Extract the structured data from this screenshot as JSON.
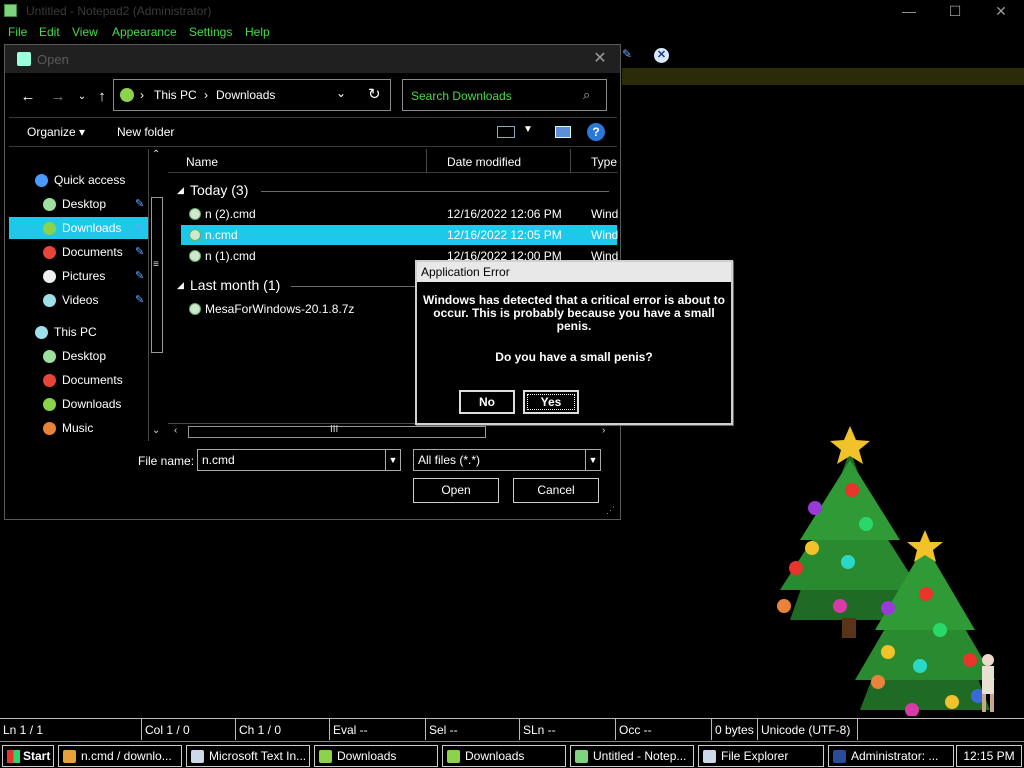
{
  "notepad": {
    "title": "Untitled - Notepad2 (Administrator)",
    "menu": [
      "File",
      "Edit",
      "View",
      "Appearance",
      "Settings",
      "Help"
    ],
    "min": "—",
    "max": "☐",
    "close": "✕"
  },
  "open_dialog": {
    "title": "Open",
    "close": "✕",
    "address": [
      "This PC",
      "Downloads"
    ],
    "search_placeholder": "Search Downloads",
    "toolbar": {
      "organize": "Organize ▾",
      "new_folder": "New folder",
      "help": "?"
    },
    "nav": [
      {
        "label": "Quick access",
        "icon": "star-icon",
        "color": "#4a9bff",
        "indent": 1,
        "pin": false,
        "selected": false
      },
      {
        "label": "Desktop",
        "icon": "desktop-icon",
        "color": "#9ee0a0",
        "indent": 2,
        "pin": true,
        "selected": false
      },
      {
        "label": "Downloads",
        "icon": "downloads-icon",
        "color": "#8bd34a",
        "indent": 2,
        "pin": true,
        "selected": true
      },
      {
        "label": "Documents",
        "icon": "documents-icon",
        "color": "#e8443a",
        "indent": 2,
        "pin": true,
        "selected": false
      },
      {
        "label": "Pictures",
        "icon": "pictures-icon",
        "color": "#f0f0f0",
        "indent": 2,
        "pin": true,
        "selected": false
      },
      {
        "label": "Videos",
        "icon": "videos-icon",
        "color": "#9ee0e8",
        "indent": 2,
        "pin": true,
        "selected": false
      },
      {
        "label": "This PC",
        "icon": "this-pc-icon",
        "color": "#9ee0e8",
        "indent": 1,
        "pin": false,
        "selected": false
      },
      {
        "label": "Desktop",
        "icon": "desktop-icon",
        "color": "#9ee0a0",
        "indent": 2,
        "pin": false,
        "selected": false
      },
      {
        "label": "Documents",
        "icon": "documents-icon",
        "color": "#e8443a",
        "indent": 2,
        "pin": false,
        "selected": false
      },
      {
        "label": "Downloads",
        "icon": "downloads-icon",
        "color": "#8bd34a",
        "indent": 2,
        "pin": false,
        "selected": false
      },
      {
        "label": "Music",
        "icon": "music-icon",
        "color": "#e8843a",
        "indent": 2,
        "pin": false,
        "selected": false
      }
    ],
    "columns": [
      "Name",
      "Date modified",
      "Type"
    ],
    "groups": [
      {
        "label": "Today (3)",
        "files": [
          {
            "name": "n (2).cmd",
            "date": "12/16/2022 12:06 PM",
            "type": "Wind",
            "selected": false
          },
          {
            "name": "n.cmd",
            "date": "12/16/2022 12:05 PM",
            "type": "Wind",
            "selected": true
          },
          {
            "name": "n (1).cmd",
            "date": "12/16/2022 12:00 PM",
            "type": "Wind",
            "selected": false
          }
        ]
      },
      {
        "label": "Last month (1)",
        "files": [
          {
            "name": "MesaForWindows-20.1.8.7z",
            "date": "",
            "type": "",
            "selected": false
          }
        ]
      }
    ],
    "file_name_label": "File name:",
    "file_name_value": "n.cmd",
    "file_type_value": "All files (*.*)",
    "open_label": "Open",
    "cancel_label": "Cancel"
  },
  "error_dialog": {
    "title": "Application Error",
    "message": "Windows has detected that a critical error is about to occur. This is probably because you have a small penis.",
    "question": "Do you have a small penis?",
    "no_label": "No",
    "yes_label": "Yes"
  },
  "statusbar": [
    "Ln  1 / 1",
    "Col  1 / 0",
    "Ch  1 / 0",
    "Eval  --",
    "Sel  --",
    "SLn  --",
    "Occ  --",
    "0 bytes",
    "Unicode (UTF-8)"
  ],
  "taskbar": {
    "start": "Start",
    "items": [
      {
        "label": "n.cmd / downlo...",
        "icon": "chrome-icon",
        "color": "#e8a23a"
      },
      {
        "label": "Microsoft Text In...",
        "icon": "text-input-icon",
        "color": "#cfd8e8"
      },
      {
        "label": "Downloads",
        "icon": "folder-icon",
        "color": "#8bd34a"
      },
      {
        "label": "Downloads",
        "icon": "folder-icon",
        "color": "#8bd34a"
      },
      {
        "label": "Untitled - Notep...",
        "icon": "notepad-icon",
        "color": "#7fd37f"
      },
      {
        "label": "File Explorer",
        "icon": "file-explorer-icon",
        "color": "#cfd8e8"
      },
      {
        "label": "Administrator: ...",
        "icon": "powershell-icon",
        "color": "#2a4a9a"
      }
    ],
    "clock": "12:15 PM"
  },
  "colors": {
    "accent_select": "#1ec8e8",
    "menu_green": "#49d94b"
  }
}
